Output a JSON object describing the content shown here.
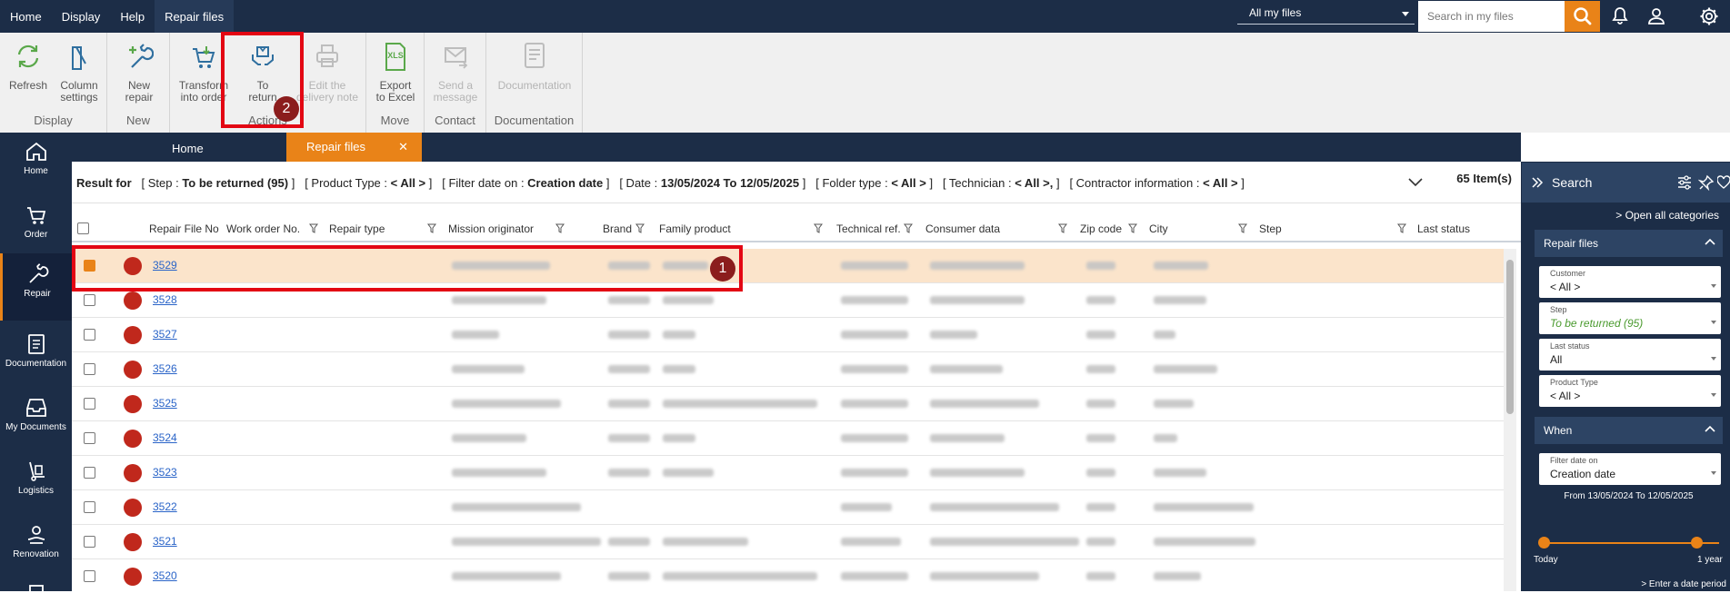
{
  "topbar": {
    "menu": [
      "Home",
      "Display",
      "Help",
      "Repair files"
    ],
    "active_menu": "Repair files",
    "file_scope": "All my files",
    "search_placeholder": "Search in my files"
  },
  "ribbon": {
    "groups": [
      {
        "label": "Display",
        "buttons": [
          {
            "l1": "Refresh",
            "l2": ""
          },
          {
            "l1": "Column",
            "l2": "settings"
          }
        ]
      },
      {
        "label": "New",
        "buttons": [
          {
            "l1": "New",
            "l2": "repair"
          }
        ]
      },
      {
        "label": "Actions",
        "buttons": [
          {
            "l1": "Transform",
            "l2": "into order"
          },
          {
            "l1": "To",
            "l2": "return"
          },
          {
            "l1": "Edit the",
            "l2": "delivery note"
          }
        ]
      },
      {
        "label": "Move",
        "buttons": [
          {
            "l1": "Export",
            "l2": "to Excel"
          }
        ]
      },
      {
        "label": "Contact",
        "buttons": [
          {
            "l1": "Send a",
            "l2": "message"
          }
        ]
      },
      {
        "label": "Documentation",
        "buttons": [
          {
            "l1": "Documentation",
            "l2": ""
          }
        ]
      }
    ]
  },
  "leftnav": [
    "Home",
    "Order",
    "Repair",
    "Documentation",
    "My Documents",
    "Logistics",
    "Renovation"
  ],
  "tabs": {
    "home": "Home",
    "active": "Repair files",
    "close": "✕"
  },
  "result": {
    "prefix": "Result for",
    "step_label": "[ Step : ",
    "step_value": "To be returned (95)",
    "step_close": " ]",
    "product_label": "[ Product Type : ",
    "product_value": "< All >",
    "product_close": " ]",
    "filterdate_label": "[ Filter date on : ",
    "filterdate_value": "Creation date",
    "filterdate_close": " ]",
    "date_label": "[ Date : ",
    "date_value": "13/05/2024 To 12/05/2025",
    "date_close": " ]",
    "folder_label": "[ Folder type : ",
    "folder_value": "< All >",
    "folder_close": " ]",
    "tech_label": "[ Technician : ",
    "tech_value": "< All >,",
    "tech_close": " ]",
    "contractor_label": "[ Contractor information : ",
    "contractor_value": "< All >",
    "contractor_close": " ]",
    "items": "65 Item(s)"
  },
  "columns": [
    "Repair File No",
    "Work order No.",
    "Repair type",
    "Mission originator",
    "Brand",
    "Family product",
    "Technical ref.",
    "Consumer data",
    "Zip code",
    "City",
    "Step",
    "Last status"
  ],
  "rows": [
    {
      "file_no": "3529",
      "selected": true
    },
    {
      "file_no": "3528",
      "selected": false
    },
    {
      "file_no": "3527",
      "selected": false
    },
    {
      "file_no": "3526",
      "selected": false
    },
    {
      "file_no": "3525",
      "selected": false
    },
    {
      "file_no": "3524",
      "selected": false
    },
    {
      "file_no": "3523",
      "selected": false
    },
    {
      "file_no": "3522",
      "selected": false
    },
    {
      "file_no": "3521",
      "selected": false
    },
    {
      "file_no": "3520",
      "selected": false
    }
  ],
  "annotations": {
    "one": "1",
    "two": "2"
  },
  "search_panel": {
    "title": "Search",
    "open_all": "> Open all categories",
    "repair_files": "Repair files",
    "fields": [
      {
        "label": "Customer",
        "value": "< All >"
      },
      {
        "label": "Step",
        "value": "To be returned (95)"
      },
      {
        "label": "Last status",
        "value": "All"
      },
      {
        "label": "Product Type",
        "value": "< All >"
      }
    ],
    "when": "When",
    "filter_date_label": "Filter date on",
    "filter_date_value": "Creation date",
    "range": "From 13/05/2024 To 12/05/2025",
    "today": "Today",
    "year": "1 year",
    "enter_date": "> Enter a date period"
  },
  "colors": {
    "accent": "#e98318",
    "navy": "#1c2d47",
    "status": "#c0281c",
    "highlight": "#e30613"
  }
}
